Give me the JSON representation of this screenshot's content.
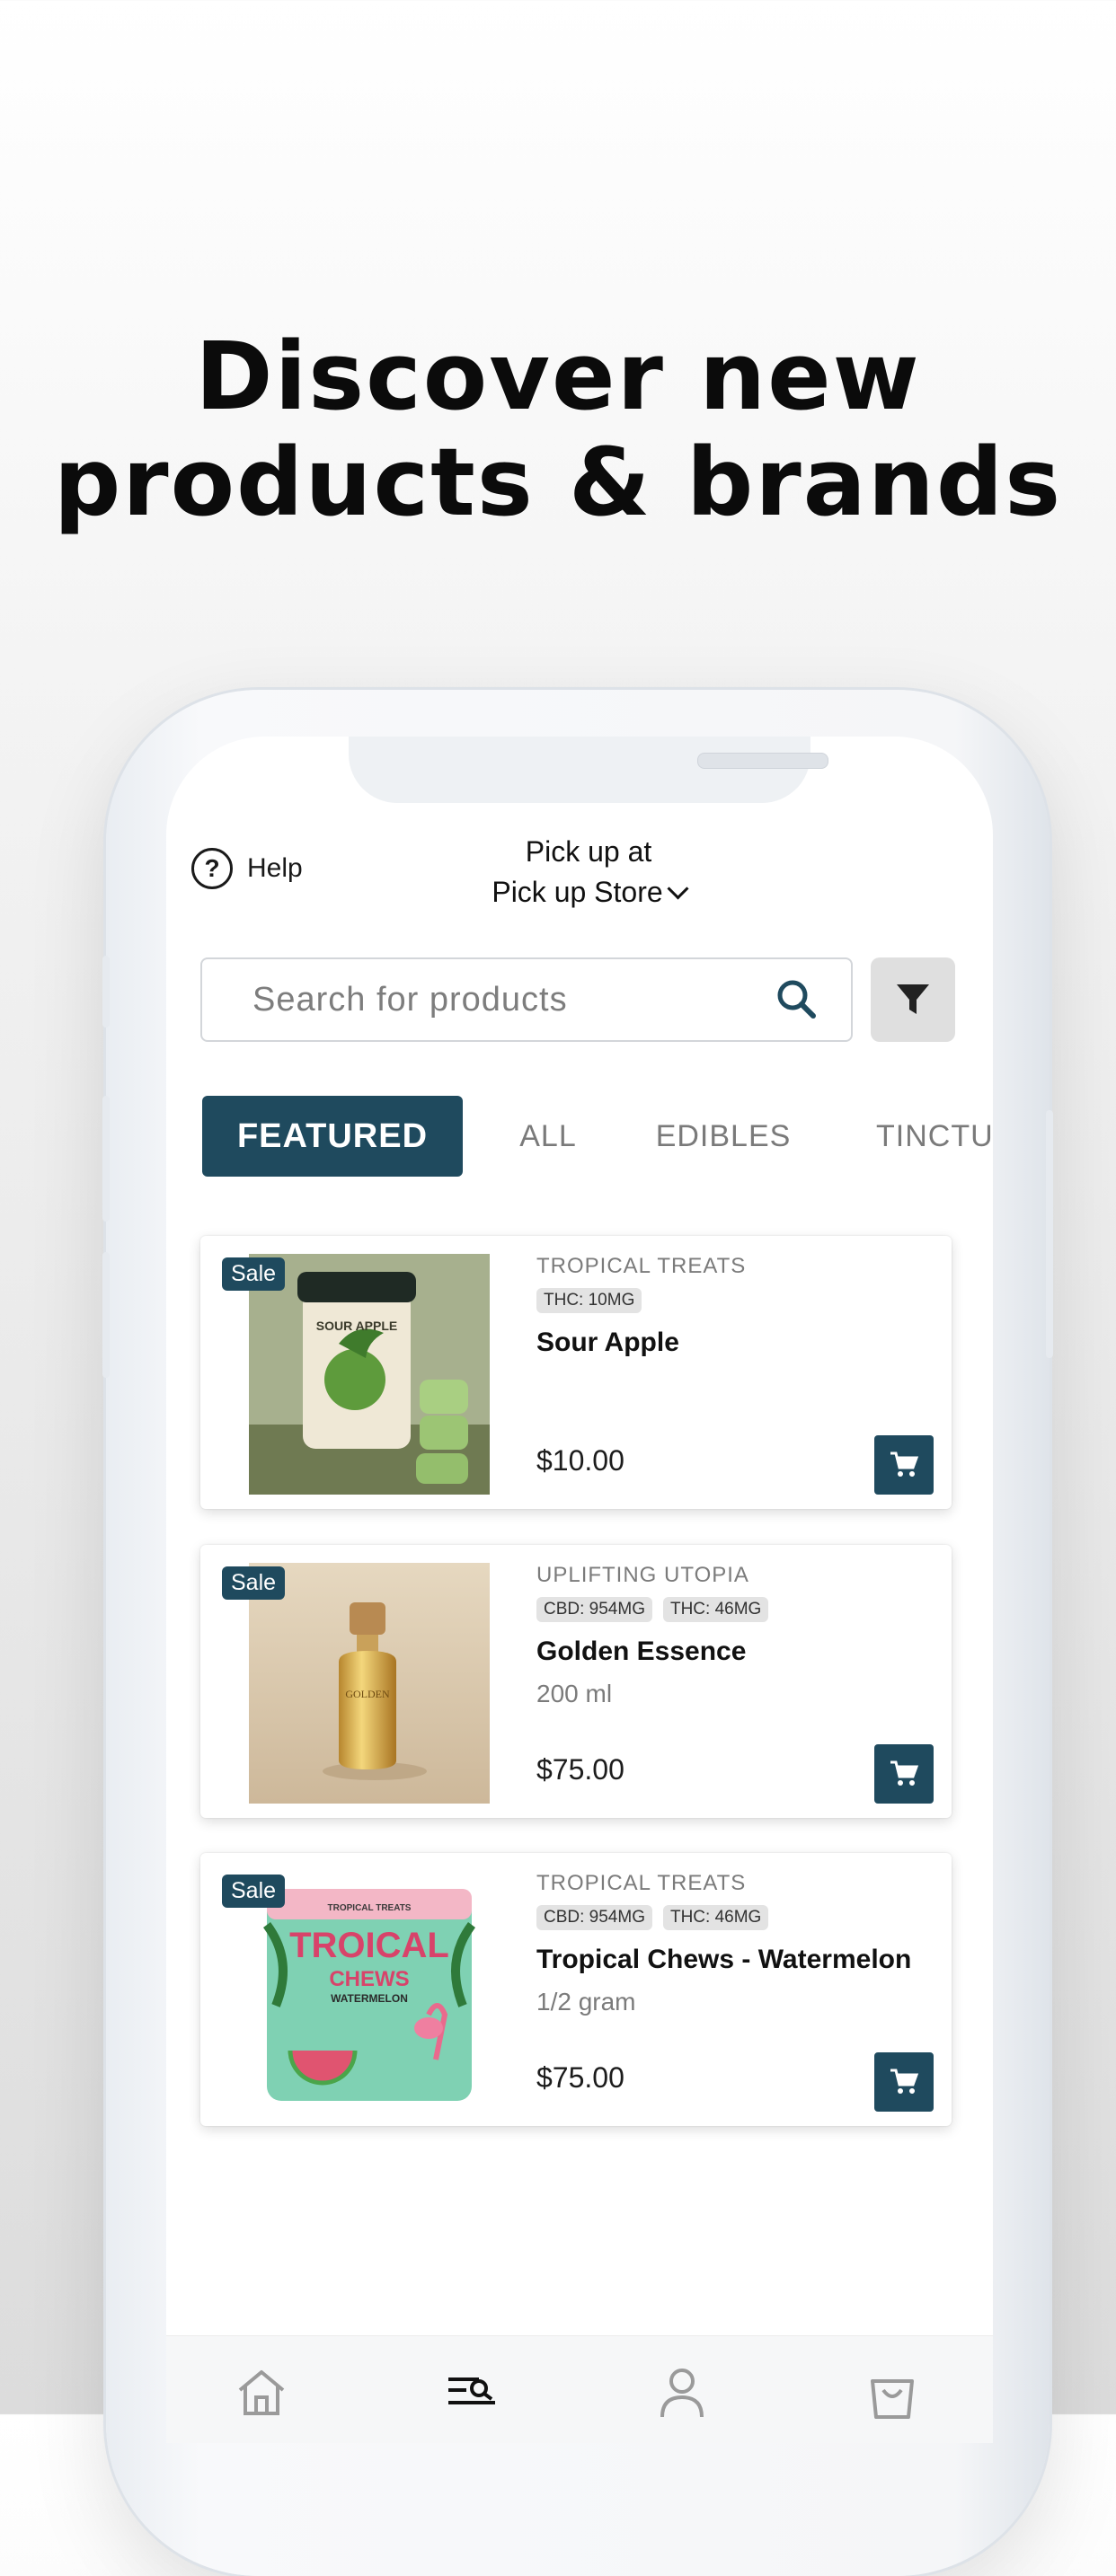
{
  "headline": {
    "line1": "Discover new",
    "line2": "products & brands"
  },
  "header": {
    "help_label": "Help",
    "help_icon": "help-circle-icon",
    "pickup_line1": "Pick up at",
    "pickup_store": "Pick up Store"
  },
  "search": {
    "placeholder": "Search for products",
    "value": ""
  },
  "tabs": [
    {
      "label": "FEATURED",
      "active": true
    },
    {
      "label": "ALL",
      "active": false
    },
    {
      "label": "EDIBLES",
      "active": false
    },
    {
      "label": "TINCTU",
      "active": false
    }
  ],
  "products": [
    {
      "badge": "Sale",
      "brand": "TROPICAL TREATS",
      "chips": [
        "THC: 10MG"
      ],
      "name": "Sour Apple",
      "size": "",
      "price": "$10.00",
      "image_text": "SOUR APPLE"
    },
    {
      "badge": "Sale",
      "brand": "UPLIFTING UTOPIA",
      "chips": [
        "CBD: 954MG",
        "THC: 46MG"
      ],
      "name": "Golden Essence",
      "size": "200 ml",
      "price": "$75.00",
      "image_text": "GOLDEN"
    },
    {
      "badge": "Sale",
      "brand": "TROPICAL TREATS",
      "chips": [
        "CBD: 954MG",
        "THC: 46MG"
      ],
      "name": "Tropical Chews - Watermelon",
      "size": "1/2 gram",
      "price": "$75.00",
      "image_text_1": "TROICAL",
      "image_text_2": "CHEWS",
      "image_text_3": "WATERMELON"
    }
  ],
  "bottom_nav": [
    "home-icon",
    "search-list-icon",
    "account-icon",
    "bag-icon"
  ],
  "colors": {
    "primary": "#1f4a5e",
    "filter_bg": "#dfdfdf"
  }
}
